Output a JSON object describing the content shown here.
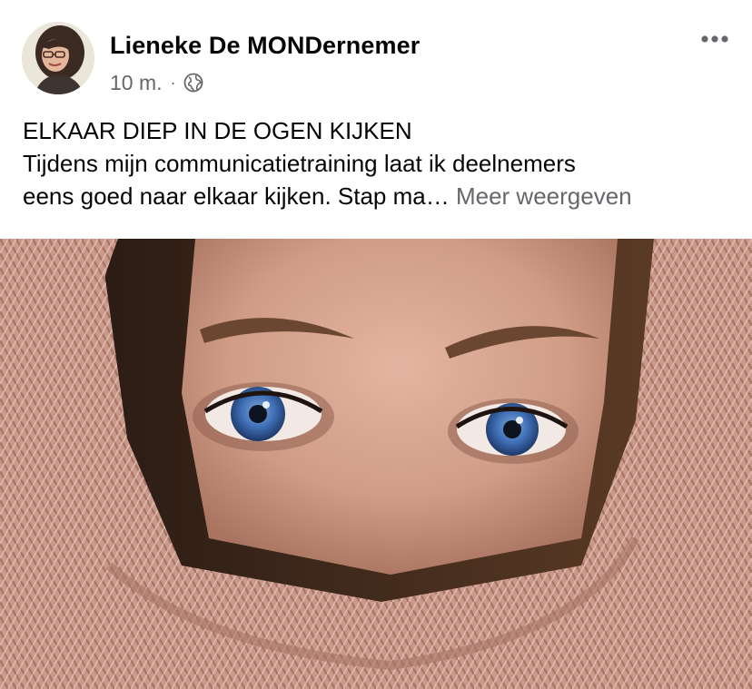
{
  "post": {
    "author": "Lieneke De MONDernemer",
    "timestamp": "10 m.",
    "separator": "·",
    "audience_icon": "globe-icon",
    "more_icon": "more-dots-icon",
    "title_line": "ELKAAR DIEP IN DE OGEN KIJKEN",
    "text_line_1": "Tijdens mijn communicatietraining laat ik deelnemers",
    "text_line_2": "eens goed naar elkaar kijken. Stap ma…",
    "see_more_label": "Meer weergeven"
  },
  "colors": {
    "text_primary": "#050505",
    "text_secondary": "#65676b",
    "background": "#ffffff",
    "iris": "#3f6fb6",
    "sweater": "#c99a8c"
  }
}
